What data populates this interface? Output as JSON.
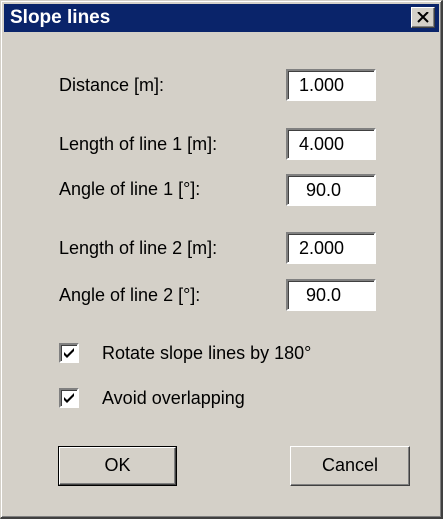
{
  "window": {
    "title": "Slope lines",
    "close_icon": "close-icon"
  },
  "fields": [
    {
      "label": "Distance [m]:",
      "value": "1.000"
    },
    {
      "label": "Length of line 1 [m]:",
      "value": "4.000"
    },
    {
      "label": "Angle of line 1 [°]:",
      "value": "90.0"
    },
    {
      "label": "Length of line 2 [m]:",
      "value": "2.000"
    },
    {
      "label": "Angle of line 2 [°]:",
      "value": "90.0"
    }
  ],
  "checkboxes": [
    {
      "label": "Rotate slope lines by 180°",
      "checked": true
    },
    {
      "label": "Avoid overlapping",
      "checked": true
    }
  ],
  "buttons": {
    "ok": "OK",
    "cancel": "Cancel"
  },
  "colors": {
    "titlebar": "#0a246a",
    "face": "#d4d0c8"
  }
}
